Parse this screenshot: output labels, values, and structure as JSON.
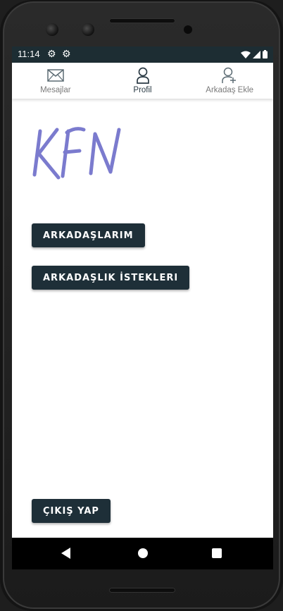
{
  "status_bar": {
    "time": "11:14",
    "icons": [
      "gear-icon",
      "gear-icon",
      "wifi-icon",
      "signal-icon",
      "battery-icon"
    ]
  },
  "tabs": [
    {
      "label": "Mesajlar",
      "icon": "envelope-icon",
      "active": false
    },
    {
      "label": "Profil",
      "icon": "user-icon",
      "active": true
    },
    {
      "label": "Arkadaş Ekle",
      "icon": "add-user-icon",
      "active": false
    }
  ],
  "logo": {
    "text": "KFN",
    "color": "#7b7bce"
  },
  "buttons": {
    "friends": "ARKADAŞLARIM",
    "requests": "ARKADAŞLIK İSTEKLERI",
    "logout": "ÇIKIŞ YAP"
  },
  "colors": {
    "status_bar": "#1d2d33",
    "button": "#1e2f38",
    "logo": "#7b7bce"
  },
  "nav": {
    "icons": [
      "back-icon",
      "home-icon",
      "recents-icon"
    ]
  }
}
